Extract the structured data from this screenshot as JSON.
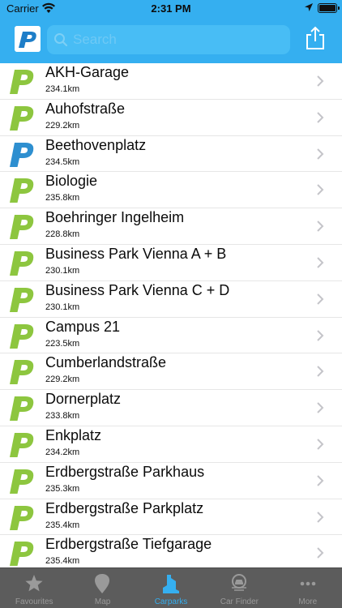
{
  "status_bar": {
    "carrier": "Carrier",
    "time": "2:31 PM"
  },
  "nav": {
    "logo_icon": "p-logo-icon",
    "search_placeholder": "Search",
    "share_icon": "share-icon"
  },
  "carparks": [
    {
      "name": "AKH-Garage",
      "distance": "234.1km",
      "logo_color": "#8dc63f"
    },
    {
      "name": "Auhofstraße",
      "distance": "229.2km",
      "logo_color": "#8dc63f"
    },
    {
      "name": "Beethovenplatz",
      "distance": "234.5km",
      "logo_color": "#2e8fd0"
    },
    {
      "name": "Biologie",
      "distance": "235.8km",
      "logo_color": "#8dc63f"
    },
    {
      "name": "Boehringer Ingelheim",
      "distance": "228.8km",
      "logo_color": "#8dc63f"
    },
    {
      "name": "Business Park Vienna A + B",
      "distance": "230.1km",
      "logo_color": "#8dc63f"
    },
    {
      "name": "Business Park Vienna C + D",
      "distance": "230.1km",
      "logo_color": "#8dc63f"
    },
    {
      "name": "Campus 21",
      "distance": "223.5km",
      "logo_color": "#8dc63f"
    },
    {
      "name": "Cumberlandstraße",
      "distance": "229.2km",
      "logo_color": "#8dc63f"
    },
    {
      "name": "Dornerplatz",
      "distance": "233.8km",
      "logo_color": "#8dc63f"
    },
    {
      "name": "Enkplatz",
      "distance": "234.2km",
      "logo_color": "#8dc63f"
    },
    {
      "name": "Erdbergstraße Parkhaus",
      "distance": "235.3km",
      "logo_color": "#8dc63f"
    },
    {
      "name": "Erdbergstraße Parkplatz",
      "distance": "235.4km",
      "logo_color": "#8dc63f"
    },
    {
      "name": "Erdbergstraße Tiefgarage",
      "distance": "235.4km",
      "logo_color": "#8dc63f"
    }
  ],
  "tab_bar": {
    "tabs": [
      {
        "label": "Favourites",
        "icon": "star-icon",
        "active": false
      },
      {
        "label": "Map",
        "icon": "map-pin-icon",
        "active": false
      },
      {
        "label": "Carparks",
        "icon": "carpark-building-icon",
        "active": true
      },
      {
        "label": "Car Finder",
        "icon": "car-finder-icon",
        "active": false
      },
      {
        "label": "More",
        "icon": "more-dots-icon",
        "active": false
      }
    ]
  },
  "colors": {
    "header_blue": "#35aff0",
    "active_tab": "#35aff0",
    "inactive_tab": "#9a9a9a",
    "tab_bar_bg": "#5c5c5c",
    "green_logo": "#8dc63f",
    "blue_logo": "#2e8fd0"
  }
}
